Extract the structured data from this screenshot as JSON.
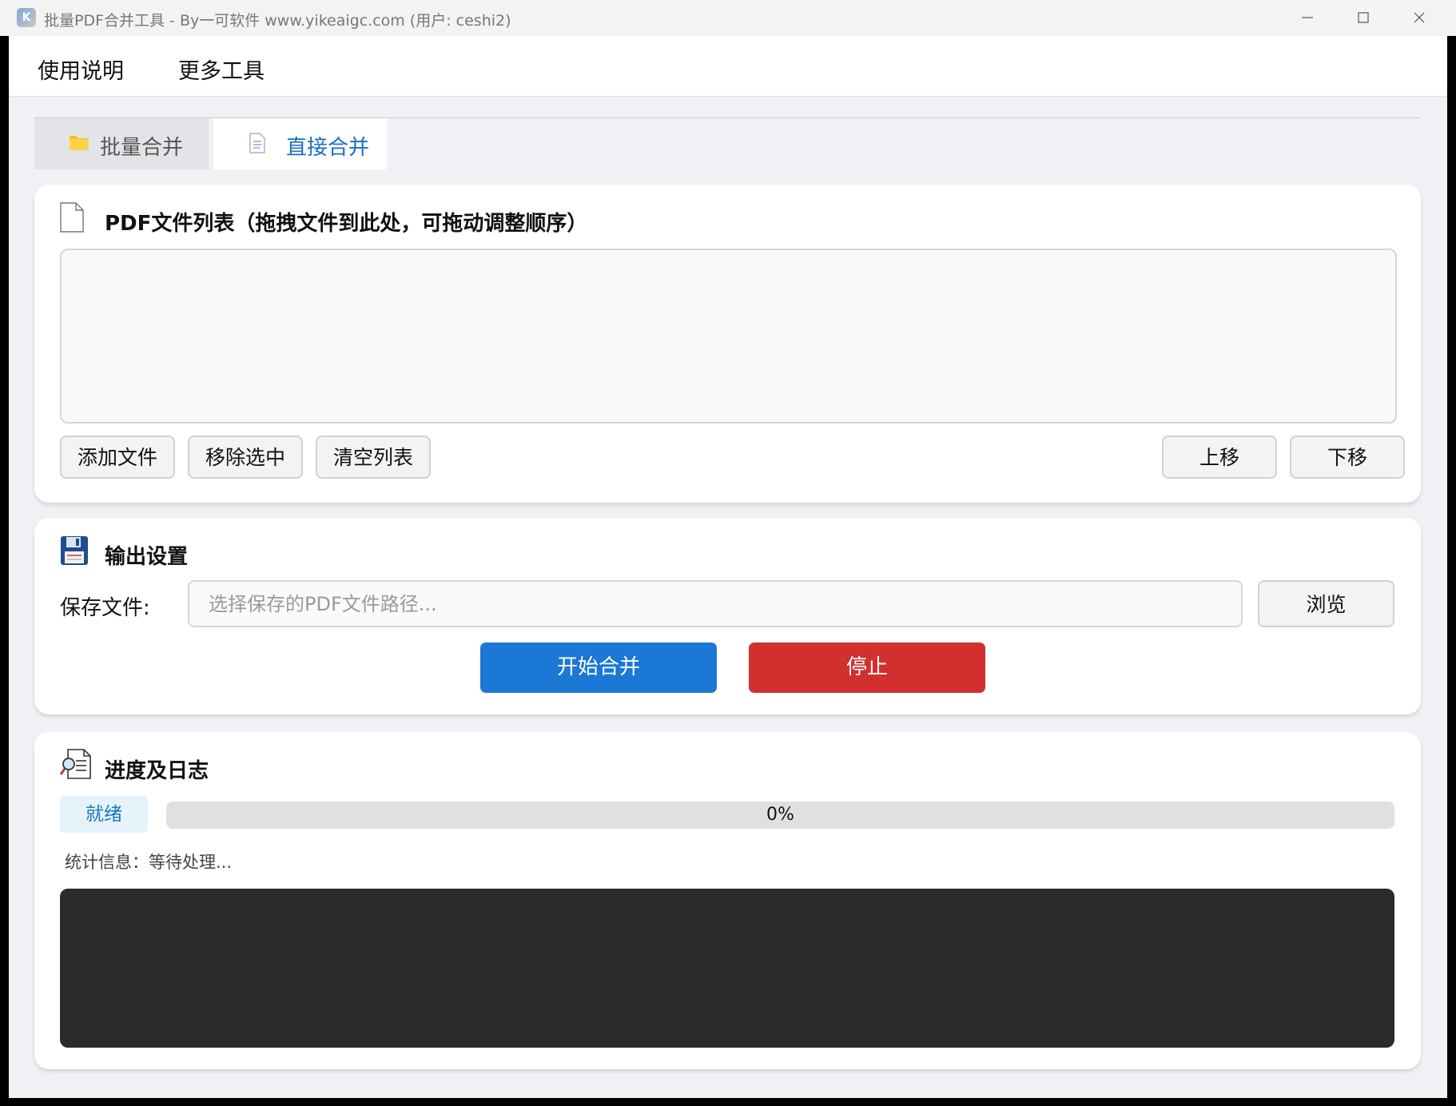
{
  "window": {
    "title": "批量PDF合并工具 - By一可软件 www.yikeaigc.com (用户: ceshi2)",
    "app_icon_glyph": "K"
  },
  "menu": {
    "items": [
      {
        "label": "使用说明"
      },
      {
        "label": "更多工具"
      }
    ]
  },
  "tabs": [
    {
      "label": "批量合并",
      "icon": "folder-icon",
      "active": false
    },
    {
      "label": "直接合并",
      "icon": "document-icon",
      "active": true
    }
  ],
  "file_section": {
    "title": "PDF文件列表（拖拽文件到此处，可拖动调整顺序）",
    "icon": "file-icon",
    "files": [],
    "buttons": {
      "add": "添加文件",
      "remove": "移除选中",
      "clear": "清空列表",
      "up": "上移",
      "down": "下移"
    }
  },
  "output_section": {
    "title": "输出设置",
    "icon": "floppy-disk-icon",
    "save_label": "保存文件:",
    "save_value": "",
    "save_placeholder": "选择保存的PDF文件路径...",
    "browse": "浏览",
    "start": "开始合并",
    "stop": "停止"
  },
  "log_section": {
    "title": "进度及日志",
    "icon": "log-search-icon",
    "status": "就绪",
    "progress_percent": 0,
    "progress_text": "0%",
    "stats": "统计信息：等待处理...",
    "log": ""
  },
  "colors": {
    "accent": "#1b78d4",
    "danger": "#d22f2f",
    "tab_active_text": "#1a6fc4",
    "log_background": "#2b2b2b"
  }
}
